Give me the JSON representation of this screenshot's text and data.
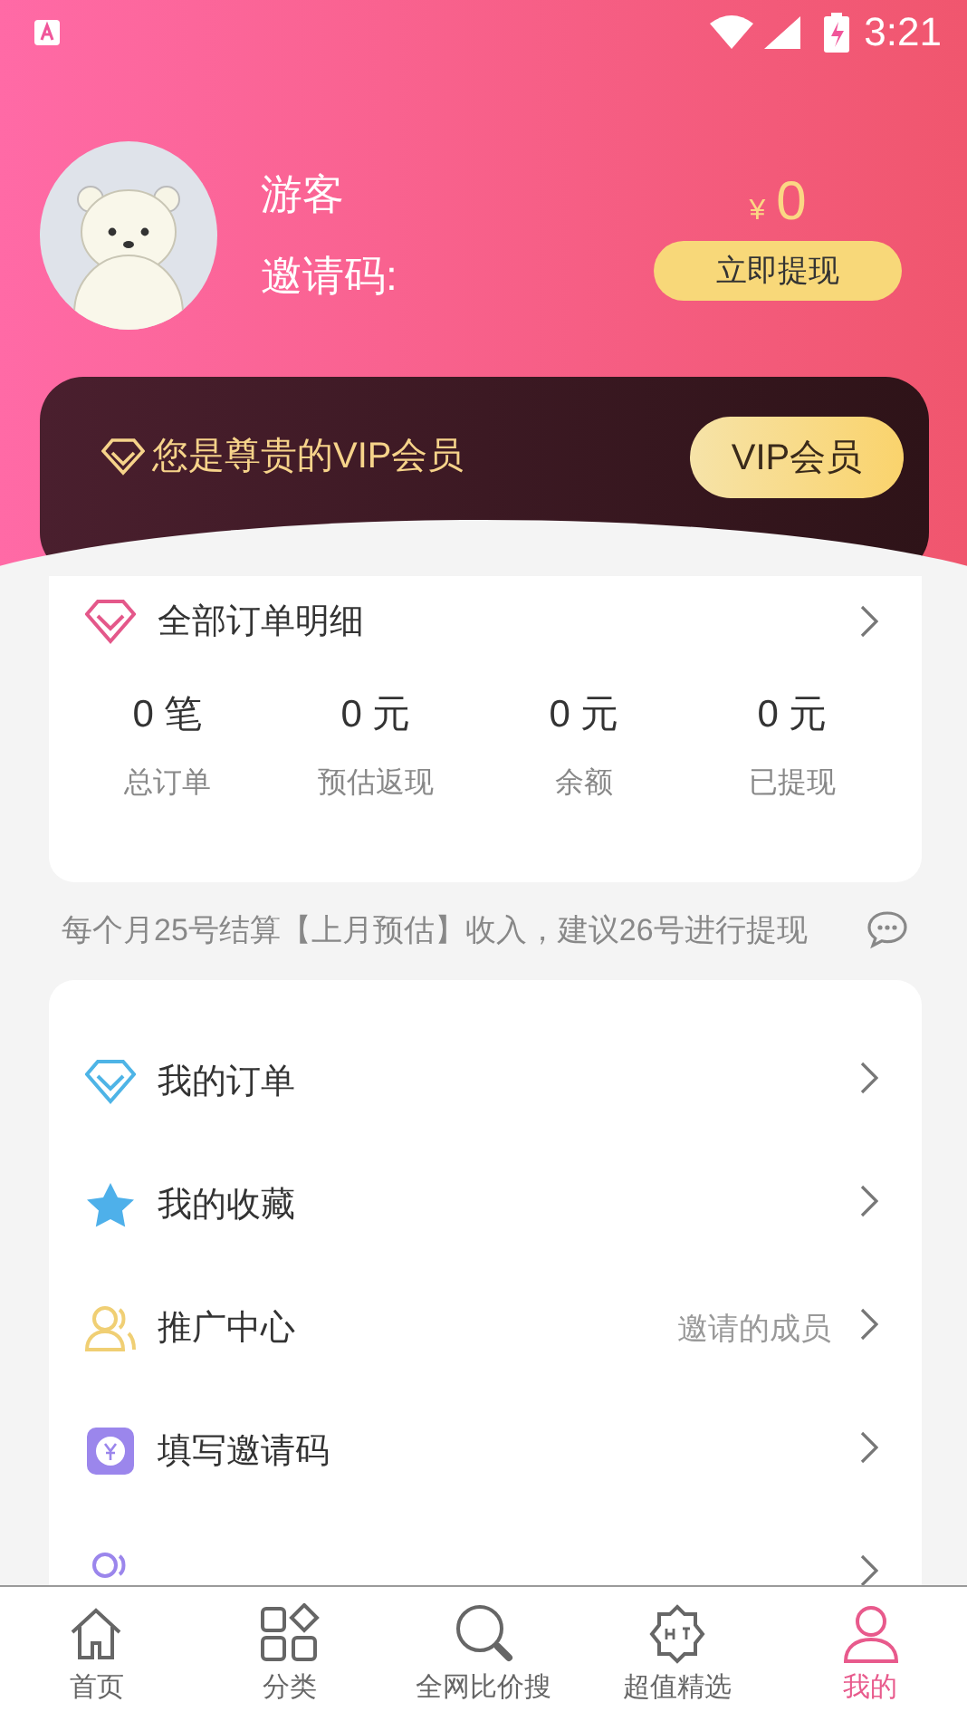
{
  "status_bar": {
    "time": "3:21"
  },
  "profile": {
    "name": "游客",
    "invite_label": "邀请码:",
    "currency": "¥",
    "balance": "0",
    "withdraw_button": "立即提现"
  },
  "vip": {
    "message": "您是尊贵的VIP会员",
    "button": "VIP会员"
  },
  "orders": {
    "title": "全部订单明细",
    "stats": [
      {
        "value": "0 笔",
        "label": "总订单"
      },
      {
        "value": "0 元",
        "label": "预估返现"
      },
      {
        "value": "0 元",
        "label": "余额"
      },
      {
        "value": "0 元",
        "label": "已提现"
      }
    ]
  },
  "notice": "每个月25号结算【上月预估】收入，建议26号进行提现",
  "menu": [
    {
      "kind": "diamond",
      "label": "我的订单"
    },
    {
      "kind": "star",
      "label": "我的收藏"
    },
    {
      "kind": "people",
      "label": "推广中心",
      "hint": "邀请的成员"
    },
    {
      "kind": "coupon",
      "label": "填写邀请码"
    },
    {
      "kind": "service"
    }
  ],
  "tabs": [
    {
      "kind": "home",
      "label": "首页",
      "selected": false
    },
    {
      "kind": "grid",
      "label": "分类",
      "selected": false
    },
    {
      "kind": "search",
      "label": "全网比价搜",
      "selected": false
    },
    {
      "kind": "hot",
      "label": "超值精选",
      "selected": false
    },
    {
      "kind": "user",
      "label": "我的",
      "selected": true
    }
  ]
}
